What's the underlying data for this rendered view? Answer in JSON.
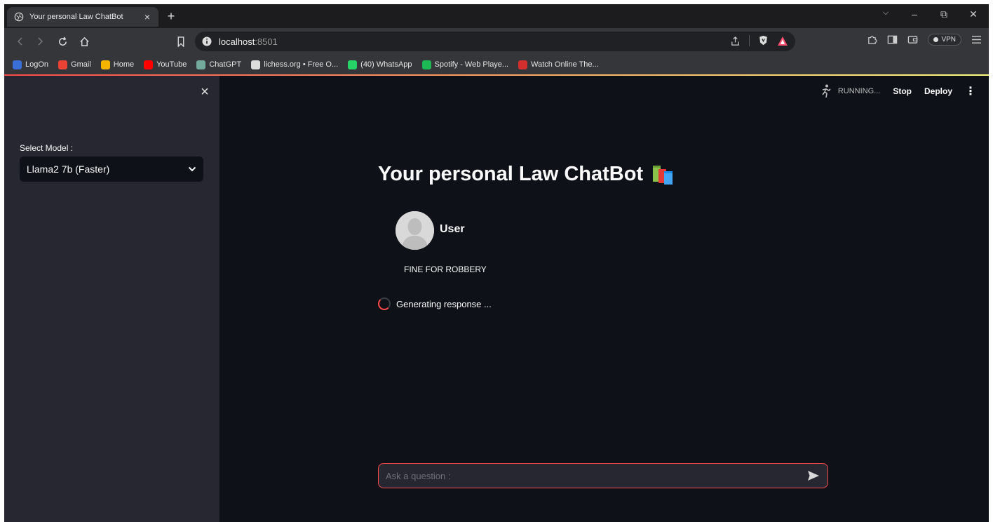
{
  "browser": {
    "tab_title": "Your personal Law ChatBot",
    "tab_close": "×",
    "new_tab": "+",
    "window_controls": {
      "tabs": "⌵",
      "minimize": "–",
      "restore": "⧉",
      "close": "✕"
    },
    "url_host": "localhost",
    "url_port": ":8501",
    "vpn_label": "VPN",
    "bookmarks": [
      {
        "label": "LogOn",
        "icon": "logon-icon",
        "color": "#3a6fd8"
      },
      {
        "label": "Gmail",
        "icon": "gmail-icon",
        "color": "#ea4335"
      },
      {
        "label": "Home",
        "icon": "home-bookmark-icon",
        "color": "#f4b400"
      },
      {
        "label": "YouTube",
        "icon": "youtube-icon",
        "color": "#ff0000"
      },
      {
        "label": "ChatGPT",
        "icon": "chatgpt-icon",
        "color": "#74aa9c"
      },
      {
        "label": "lichess.org • Free O...",
        "icon": "lichess-icon",
        "color": "#dddddd"
      },
      {
        "label": "(40) WhatsApp",
        "icon": "whatsapp-icon",
        "color": "#25d366"
      },
      {
        "label": "Spotify - Web Playe...",
        "icon": "spotify-icon",
        "color": "#1db954"
      },
      {
        "label": "Watch Online The...",
        "icon": "watch-online-icon",
        "color": "#d32f2f"
      }
    ]
  },
  "sidebar": {
    "close_icon": "×",
    "select_label": "Select Model :",
    "select_value": "Llama2 7b (Faster)"
  },
  "header": {
    "status": "RUNNING...",
    "stop": "Stop",
    "deploy": "Deploy",
    "menu": "⋮"
  },
  "main": {
    "title": "Your personal Law ChatBot",
    "title_emoji": "books-icon",
    "user_name": "User",
    "user_message": "FINE FOR ROBBERY",
    "spinner_text": "Generating response ...",
    "input_placeholder": "Ask a question :"
  },
  "colors": {
    "accent": "#ff4b4b",
    "background": "#0e1117",
    "sidebar": "#262730"
  }
}
